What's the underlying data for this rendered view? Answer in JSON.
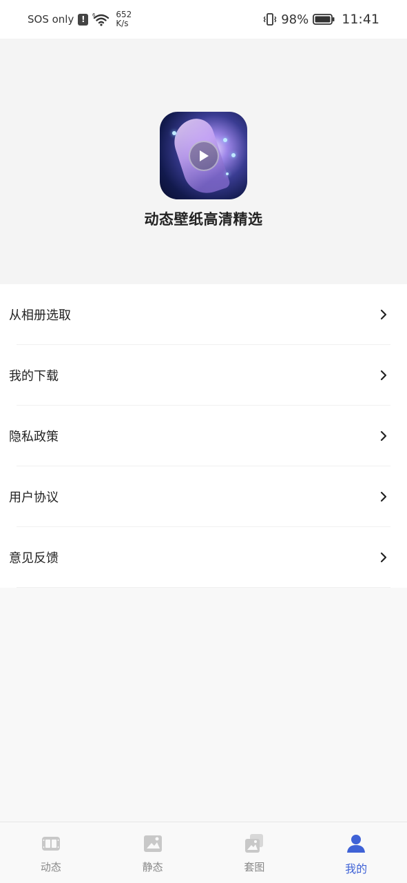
{
  "status_bar": {
    "carrier": "SOS only",
    "alert_glyph": "!",
    "signal_tag": "6",
    "net_speed_value": "652",
    "net_speed_unit": "K/s",
    "battery_percent": "98%",
    "time": "11:41"
  },
  "header": {
    "app_icon": "anime-wallpaper-play-icon",
    "app_title": "动态壁纸高清精选"
  },
  "menu": {
    "items": [
      {
        "label": "从相册选取",
        "icon": "chevron-right-icon"
      },
      {
        "label": "我的下载",
        "icon": "chevron-right-icon"
      },
      {
        "label": "隐私政策",
        "icon": "chevron-right-icon"
      },
      {
        "label": "用户协议",
        "icon": "chevron-right-icon"
      },
      {
        "label": "意见反馈",
        "icon": "chevron-right-icon"
      }
    ]
  },
  "tab_bar": {
    "tabs": [
      {
        "label": "动态",
        "icon": "film-icon",
        "active": false
      },
      {
        "label": "静态",
        "icon": "image-icon",
        "active": false
      },
      {
        "label": "套图",
        "icon": "image-set-icon",
        "active": false
      },
      {
        "label": "我的",
        "icon": "user-icon",
        "active": true
      }
    ],
    "active_color": "#3f62d6",
    "inactive_color": "#c8c8c8"
  }
}
